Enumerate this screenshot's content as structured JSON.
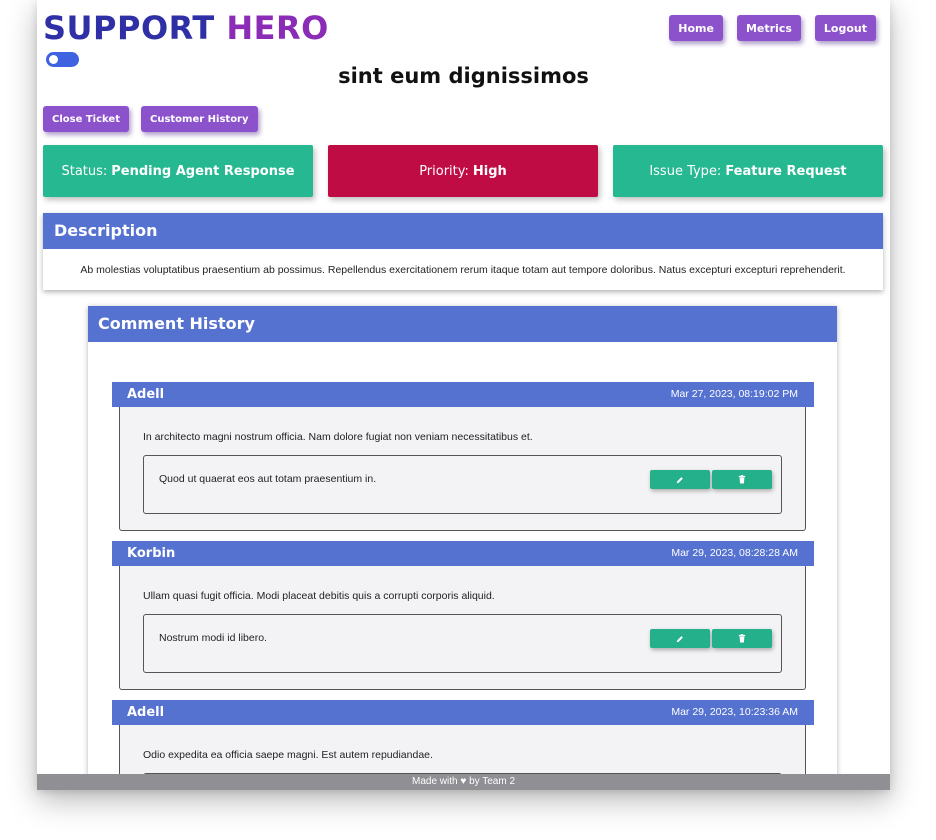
{
  "brand": {
    "word1": "SUPPORT",
    "word2": "HERO"
  },
  "nav": {
    "home": "Home",
    "metrics": "Metrics",
    "logout": "Logout"
  },
  "ticket": {
    "title": "sint eum dignissimos",
    "actions": {
      "close": "Close Ticket",
      "history": "Customer History"
    },
    "status": {
      "label": "Status:",
      "value": "Pending Agent Response",
      "color": "#26b891"
    },
    "priority": {
      "label": "Priority:",
      "value": "High",
      "color": "#c00c45"
    },
    "issue_type": {
      "label": "Issue Type:",
      "value": "Feature Request",
      "color": "#26b891"
    }
  },
  "description": {
    "heading": "Description",
    "text": "Ab molestias voluptatibus praesentium ab possimus. Repellendus exercitationem rerum itaque totam aut tempore doloribus. Natus excepturi excepturi reprehenderit."
  },
  "comment_history": {
    "heading": "Comment History",
    "comments": [
      {
        "author": "Adell",
        "date": "Mar 27, 2023, 08:19:02 PM",
        "text": "In architecto magni nostrum officia. Nam dolore fugiat non veniam necessitatibus et.",
        "reply": "Quod ut quaerat eos aut totam praesentium in."
      },
      {
        "author": "Korbin",
        "date": "Mar 29, 2023, 08:28:28 AM",
        "text": "Ullam quasi fugit officia. Modi placeat debitis quis a corrupti corporis aliquid.",
        "reply": "Nostrum modi id libero."
      },
      {
        "author": "Adell",
        "date": "Mar 29, 2023, 10:23:36 AM",
        "text": "Odio expedita ea officia saepe magni. Est autem repudiandae.",
        "reply": ""
      }
    ]
  },
  "icons": {
    "edit": "pencil-icon",
    "delete": "trash-icon",
    "heart": "heart-icon"
  },
  "footer": {
    "before": "Made with",
    "after": "by Team 2"
  }
}
